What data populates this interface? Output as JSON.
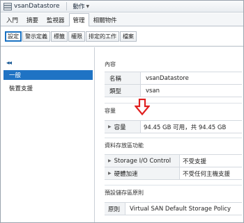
{
  "window": {
    "title": "vsanDatastore",
    "actions_label": "動作"
  },
  "tabs": [
    {
      "label": "入門",
      "active": false
    },
    {
      "label": "摘要",
      "active": false
    },
    {
      "label": "監視器",
      "active": false
    },
    {
      "label": "管理",
      "active": true
    },
    {
      "label": "相關物件",
      "active": false
    }
  ],
  "subtabs": [
    {
      "label": "設定",
      "active": true
    },
    {
      "label": "警示定義",
      "active": false
    },
    {
      "label": "標籤",
      "active": false
    },
    {
      "label": "權限",
      "active": false
    },
    {
      "label": "排定的工作",
      "active": false
    },
    {
      "label": "檔案",
      "active": false
    }
  ],
  "leftnav": {
    "collapse_glyph": "◂◂",
    "items": [
      {
        "label": "一般",
        "selected": true
      },
      {
        "label": "裝置支援",
        "selected": false
      }
    ]
  },
  "sections": {
    "properties": {
      "title": "內容",
      "rows": [
        {
          "label": "名稱",
          "value": "vsanDatastore"
        },
        {
          "label": "類型",
          "value": "vsan"
        }
      ]
    },
    "capacity": {
      "title": "容量",
      "row": {
        "label": "容量",
        "value": "94.45 GB 可用，共 94.45 GB"
      }
    },
    "storage_capabilities": {
      "title": "資料存放區功能",
      "rows": [
        {
          "label": "Storage I/O Control",
          "value": "不受支援"
        },
        {
          "label": "硬體加速",
          "value": "不受任何主機支援"
        }
      ]
    },
    "default_policy": {
      "title": "預設儲存區原則",
      "row": {
        "label": "原則",
        "value": "Virtual SAN Default Storage Policy"
      }
    }
  },
  "colors": {
    "accent": "#1f73c4",
    "arrow": "#e02020"
  }
}
